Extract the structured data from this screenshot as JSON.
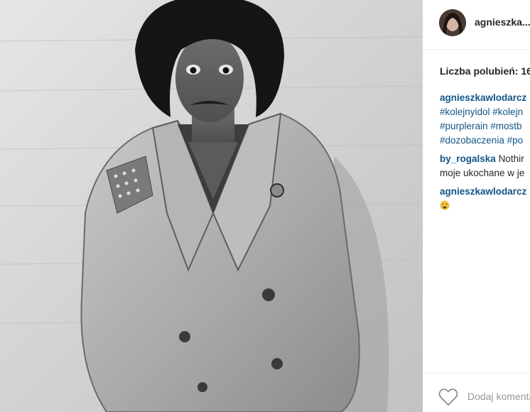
{
  "post": {
    "username": "agnieszka...",
    "avatar": {
      "icon": "profile-photo"
    },
    "likes_label": "Liczba polubień: 16"
  },
  "comments": [
    {
      "author": "agnieszkawlodarcz",
      "hashtag_lines": [
        "#kolejnyidol #kolejn",
        "#purplerain #mostb",
        "#dozobaczenia #po"
      ]
    },
    {
      "author": "by_rogalska",
      "text_first": "Nothir",
      "text_second": "moje ukochane w je"
    },
    {
      "author": "agnieszkawlodarcz",
      "emoji": "crying-face"
    }
  ],
  "footer": {
    "like_icon": "heart-outline-icon",
    "comment_placeholder": "Dodaj komentarz..."
  },
  "colors": {
    "link": "#125688",
    "text": "#262626",
    "placeholder": "#999999",
    "divider": "#efefef"
  }
}
